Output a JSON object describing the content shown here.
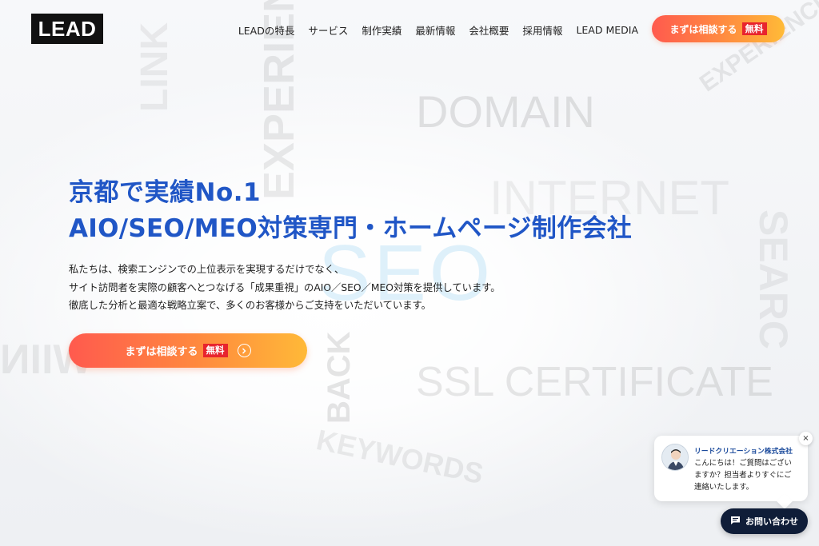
{
  "background_words": {
    "domain": "DOMAIN",
    "internet": "INTERNET",
    "seo": "SEO",
    "ssl": "SSL CERTIFICATE",
    "link": "LINK",
    "experience": "EXPERIEN",
    "search": "SEARC",
    "backlinks": "BACK",
    "keywords": "KEYWORDS",
    "mirrored": "WIIN",
    "experience_corner": "EXPERIENCE"
  },
  "header": {
    "logo": "LEAD",
    "nav": [
      "LEADの特長",
      "サービス",
      "制作実績",
      "最新情報",
      "会社概要",
      "採用情報",
      "LEAD MEDIA"
    ],
    "cta_label": "まずは相談する",
    "cta_badge": "無料"
  },
  "hero": {
    "title_line1": "京都で実績No.1",
    "title_line2": "AIO/SEO/MEO対策専門・ホームページ制作会社",
    "description": [
      "私たちは、検索エンジンでの上位表示を実現するだけでなく、",
      "サイト訪問者を実際の顧客へとつなげる「成果重視」のAIO／SEO／MEO対策を提供しています。",
      "徹底した分析と最適な戦略立案で、多くのお客様からご支持をいただいています。"
    ],
    "cta_label": "まずは相談する",
    "cta_badge": "無料"
  },
  "chat": {
    "company": "リードクリエーション株式会社",
    "message": [
      "こんにちは！ご質問はござい",
      "ますか？担当者よりすぐにご",
      "連絡いたします。"
    ],
    "close": "×",
    "button_label": "お問い合わせ"
  },
  "colors": {
    "title_blue": "#2056c6",
    "cta_gradient_start": "#ff5a4e",
    "cta_gradient_end": "#ffb938",
    "badge_red": "#e8242e",
    "chat_button": "#0f1d38"
  }
}
